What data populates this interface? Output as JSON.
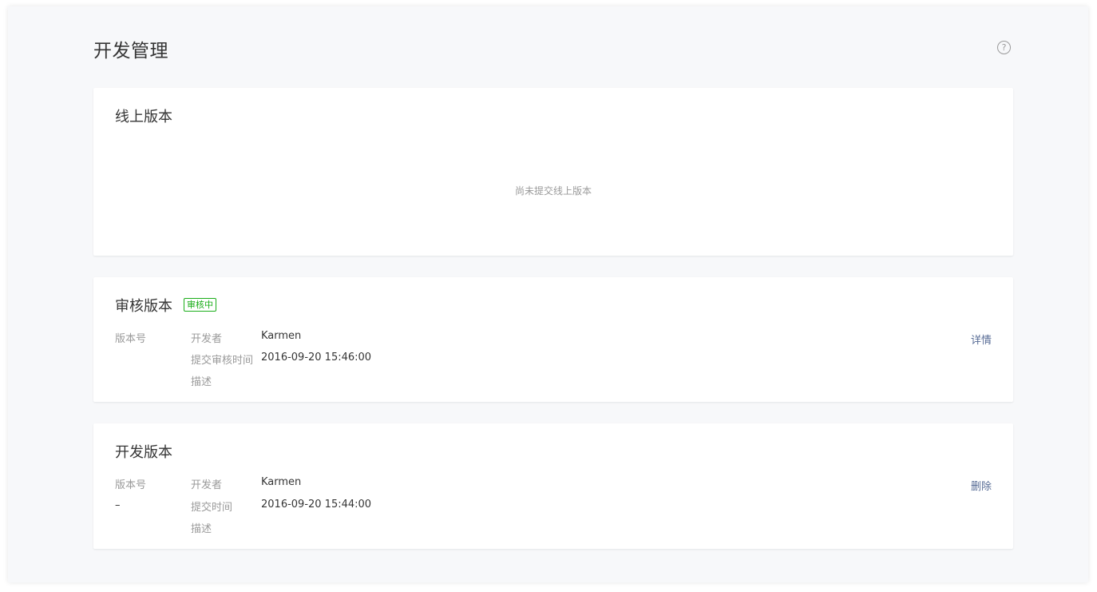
{
  "page": {
    "title": "开发管理",
    "help_icon": "?"
  },
  "online": {
    "title": "线上版本",
    "empty": "尚未提交线上版本"
  },
  "review": {
    "title": "审核版本",
    "badge": "审核中",
    "version_label": "版本号",
    "developer_label": "开发者",
    "developer": "Karmen",
    "submit_time_label": "提交审核时间",
    "submit_time": "2016-09-20 15:46:00",
    "desc_label": "描述",
    "action": "详情"
  },
  "dev": {
    "title": "开发版本",
    "version_label": "版本号",
    "version": "–",
    "developer_label": "开发者",
    "developer": "Karmen",
    "submit_time_label": "提交时间",
    "submit_time": "2016-09-20 15:44:00",
    "desc_label": "描述",
    "action": "删除"
  },
  "colors": {
    "badge_green": "#1aad19",
    "link_blue": "#576b95",
    "page_bg": "#f7f8fa"
  }
}
